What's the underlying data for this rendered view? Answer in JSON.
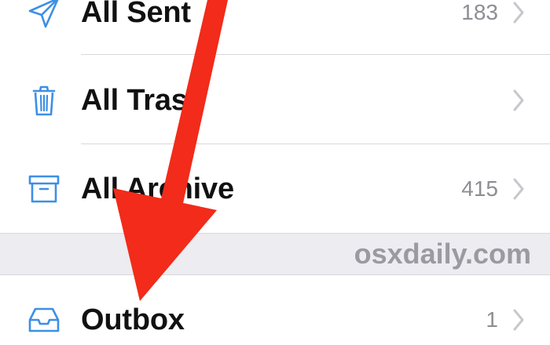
{
  "mailboxes": [
    {
      "label": "All Sent",
      "count": "183",
      "icon": "paper-plane-icon"
    },
    {
      "label": "All Trash",
      "count": "",
      "icon": "trash-icon"
    },
    {
      "label": "All Archive",
      "count": "415",
      "icon": "archive-box-icon"
    },
    {
      "label": "Outbox",
      "count": "1",
      "icon": "inbox-tray-icon"
    }
  ],
  "watermark": "osxdaily.com",
  "colors": {
    "icon_blue": "#3d8fe6",
    "annotation_red": "#f22b1a",
    "count_gray": "#8e8e93",
    "chevron_gray": "#c7c7cc",
    "section_gray": "#ececf1"
  }
}
